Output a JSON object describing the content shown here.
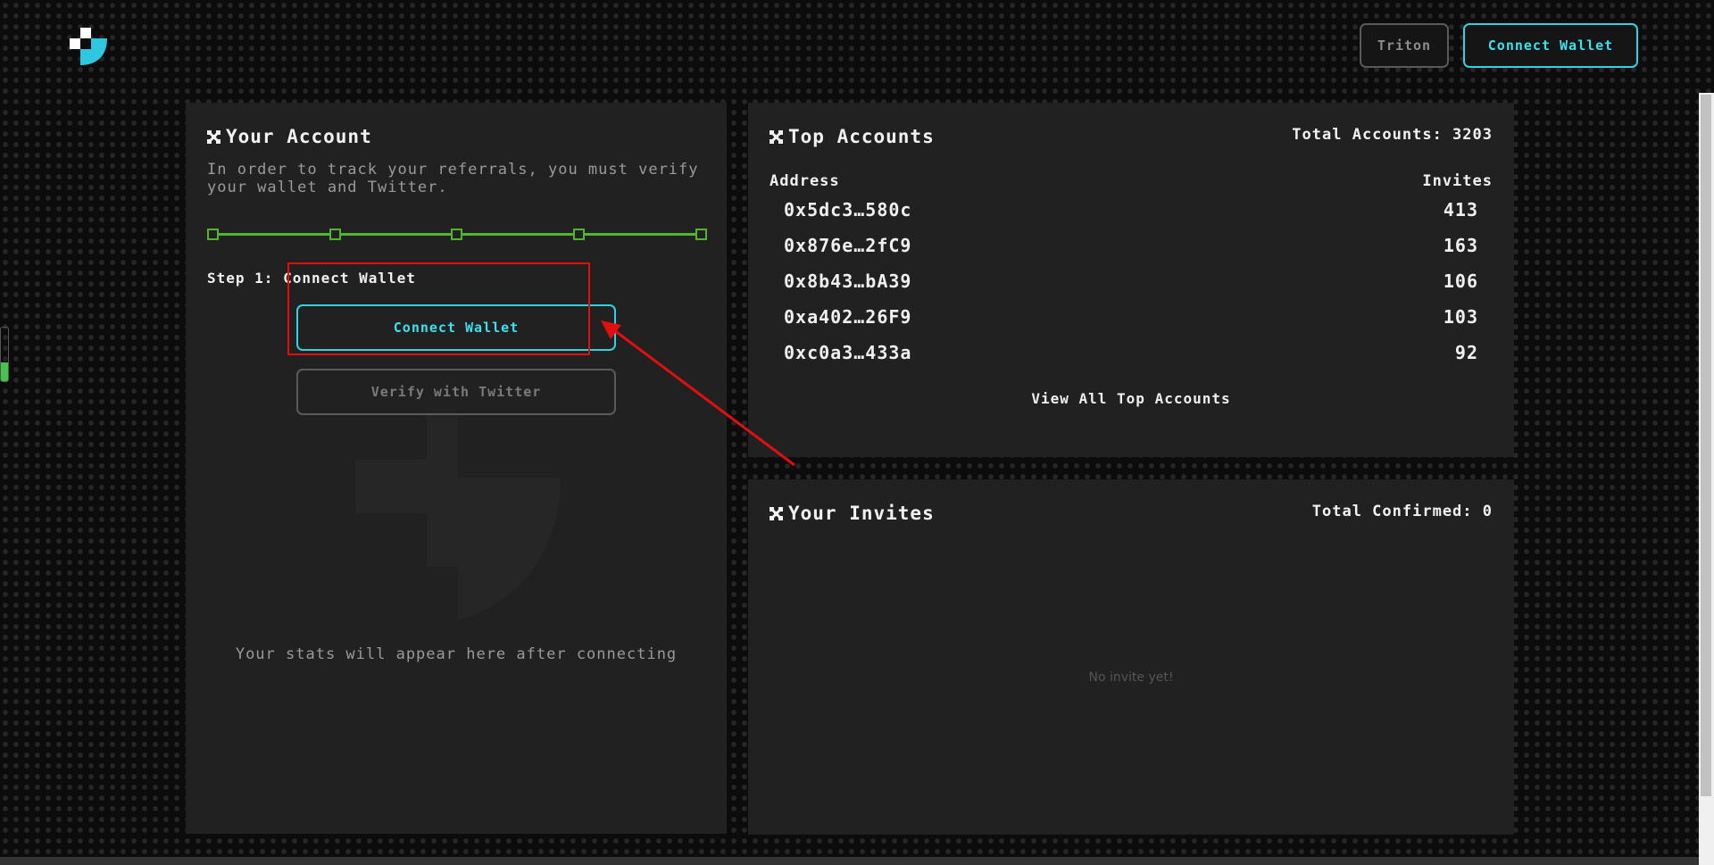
{
  "header": {
    "logo_icon": "brand-logo-icon",
    "triton_label": "Triton",
    "connect_wallet_label": "Connect Wallet",
    "accent_color": "#2fd3e3"
  },
  "account": {
    "title": "Your Account",
    "title_icon": "cross-icon",
    "intro": "In order to track your referrals, you must verify your wallet and Twitter.",
    "progress_steps": 5,
    "step_label": "Step 1: Connect Wallet",
    "connect_wallet_label": "Connect Wallet",
    "verify_twitter_label": "Verify with Twitter",
    "stats_message": "Your stats will appear here after connecting"
  },
  "top_accounts": {
    "title": "Top Accounts",
    "title_icon": "cross-icon",
    "total_label": "Total Accounts: 3203",
    "columns": [
      "Address",
      "Invites"
    ],
    "rows": [
      {
        "address": "0x5dc3…580c",
        "invites": "413"
      },
      {
        "address": "0x876e…2fC9",
        "invites": "163"
      },
      {
        "address": "0x8b43…bA39",
        "invites": "106"
      },
      {
        "address": "0xa402…26F9",
        "invites": "103"
      },
      {
        "address": "0xc0a3…433a",
        "invites": "92"
      }
    ],
    "view_all_label": "View All Top Accounts"
  },
  "invites": {
    "title": "Your Invites",
    "title_icon": "cross-icon",
    "total_label": "Total Confirmed: 0",
    "empty_message": "No invite yet!"
  },
  "side_meter_level": 0.35,
  "annotation": {
    "highlight_color": "#e30f0f"
  }
}
